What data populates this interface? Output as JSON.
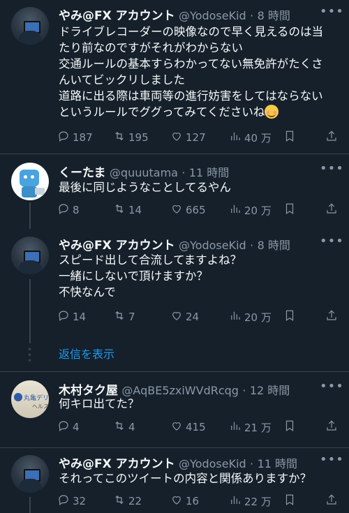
{
  "tweets": [
    {
      "name": "やみ@FX アカウント",
      "handle": "@YodoseKid",
      "time": "8 時間",
      "lines": [
        "ドライブレコーダーの映像なので早く見えるのは当",
        "たり前なのですがそれがわからない",
        "交通ルールの基本すらわかってない無免許がたくさ",
        "んいてビックリしました",
        "道路に出る際は車両等の進行妨害をしてはならない",
        "というルールでググってみてくださいね"
      ],
      "replies": "187",
      "retweets": "195",
      "likes": "127",
      "views": "40 万"
    },
    {
      "name": "くーたま",
      "handle": "@quuutama",
      "time": "11 時間",
      "lines": [
        "最後に同じようなことしてるやん"
      ],
      "replies": "8",
      "retweets": "14",
      "likes": "665",
      "views": "20 万"
    },
    {
      "name": "やみ@FX アカウント",
      "handle": "@YodoseKid",
      "time": "8 時間",
      "lines": [
        "スピード出して合流してますよね？",
        "一緒にしないで頂けますか？",
        "不快なんで"
      ],
      "replies": "14",
      "retweets": "7",
      "likes": "24",
      "views": "20 万"
    },
    {
      "name": "木村タク屋",
      "handle": "@AqBE5zxiWVdRcqg",
      "time": "12 時間",
      "lines": [
        "何キロ出てた？"
      ],
      "replies": "4",
      "retweets": "4",
      "likes": "415",
      "views": "21 万"
    },
    {
      "name": "やみ@FX アカウント",
      "handle": "@YodoseKid",
      "time": "11 時間",
      "lines": [
        "それってこのツイートの内容と関係ありますか？"
      ],
      "replies": "32",
      "retweets": "22",
      "likes": "16",
      "views": "22 万"
    }
  ],
  "show_replies": "返信を表示",
  "avatar_kimu_sign": "丸亀デリバリー地",
  "avatar_kimu_sign2": "ヘルス",
  "icons": [
    "reply-icon",
    "retweet-icon",
    "like-icon",
    "views-icon",
    "bookmark-icon",
    "share-icon",
    "more-icon"
  ],
  "colors": {
    "background": "#15202b",
    "accent": "#1d9bf0",
    "muted": "#8b98a5",
    "divider": "#38444d"
  }
}
